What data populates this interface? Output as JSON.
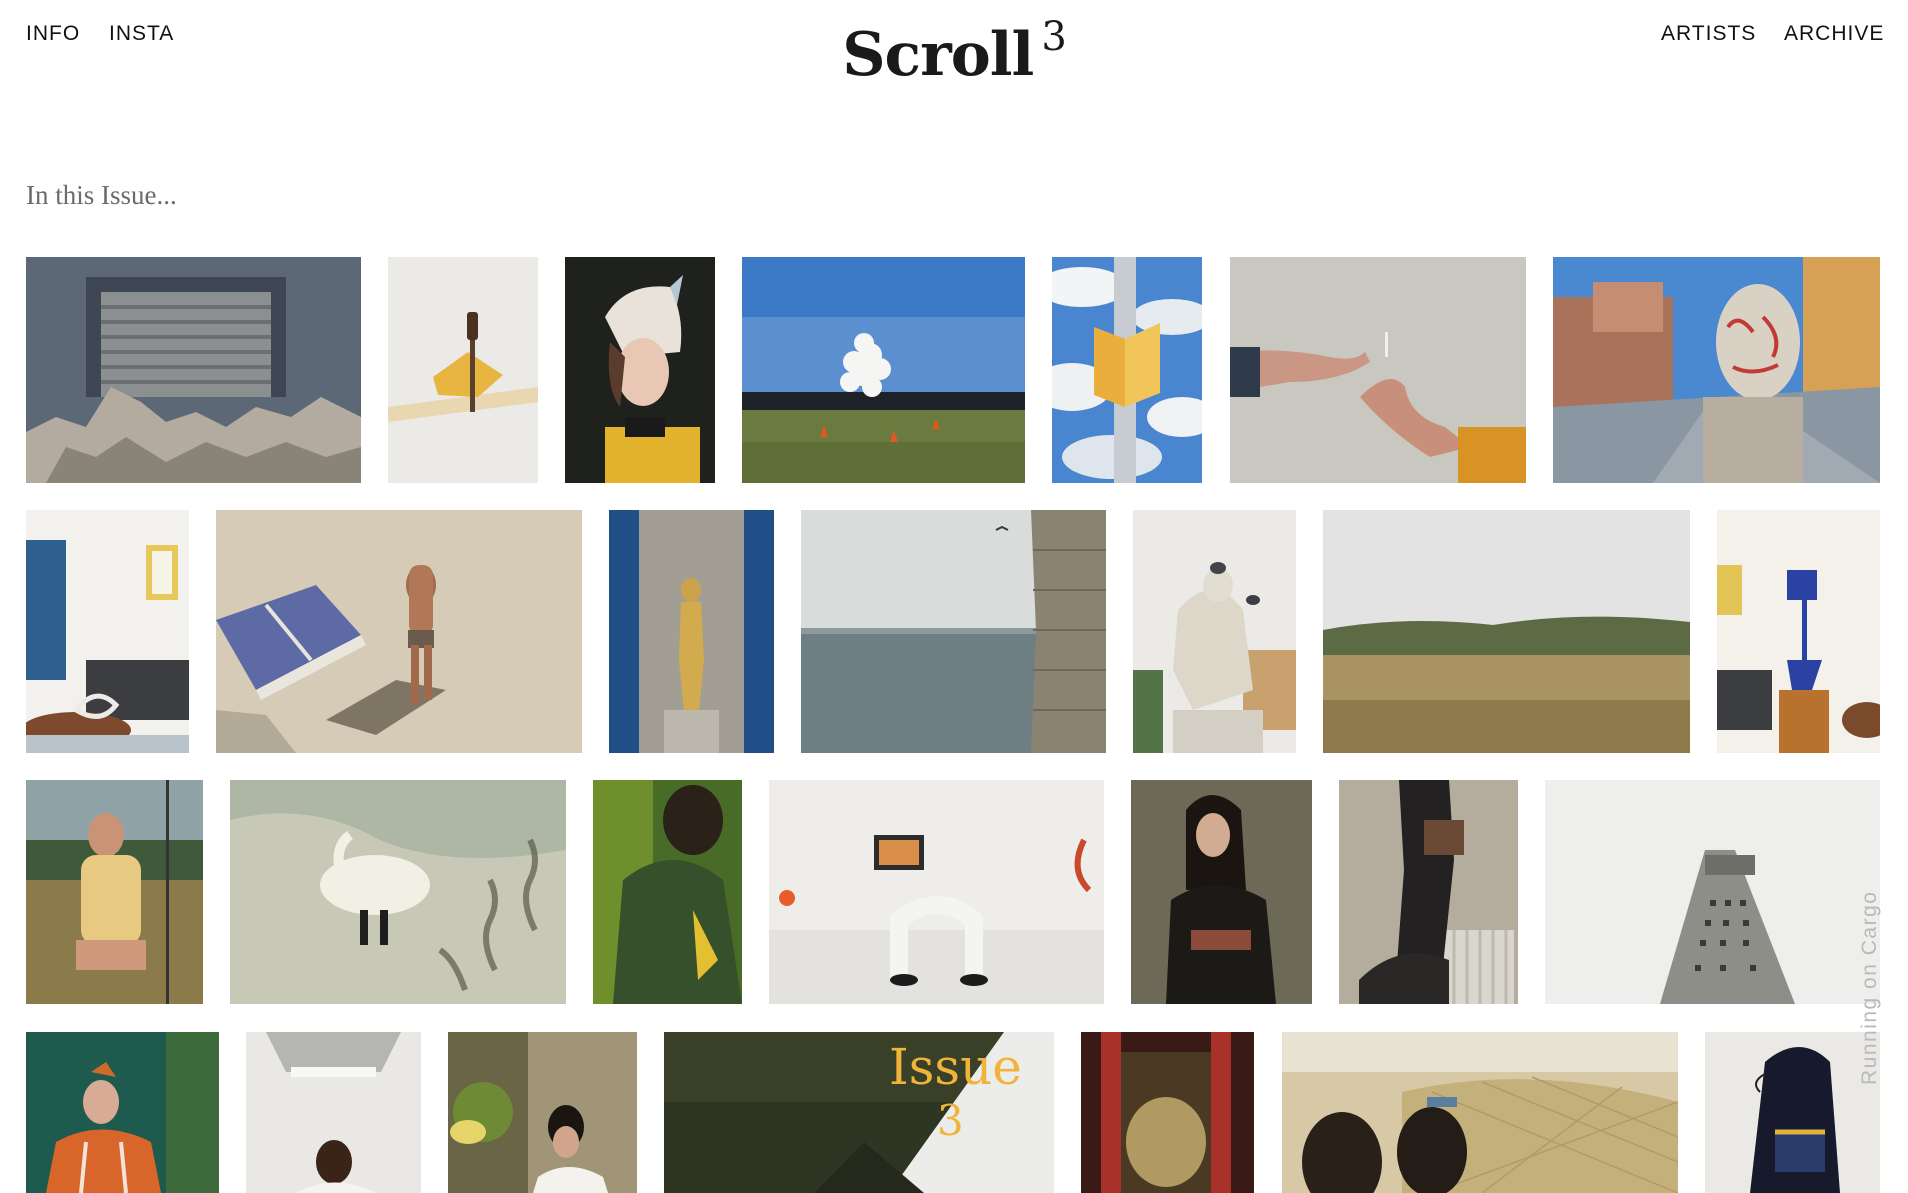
{
  "header": {
    "logo_text": "Scroll",
    "logo_superscript": "3",
    "nav_left": [
      "INFO",
      "INSTA"
    ],
    "nav_right": [
      "ARTISTS",
      "ARCHIVE"
    ]
  },
  "intro": {
    "text": "In this Issue..."
  },
  "cover": {
    "issue_word": "Issue",
    "issue_number": "3",
    "accent": "#f0b43a"
  },
  "footer": {
    "running_on": "Running on Cargo"
  },
  "colors": {
    "text": "#111111",
    "muted": "#6b6b6b",
    "cargo": "#b9b9b9"
  }
}
